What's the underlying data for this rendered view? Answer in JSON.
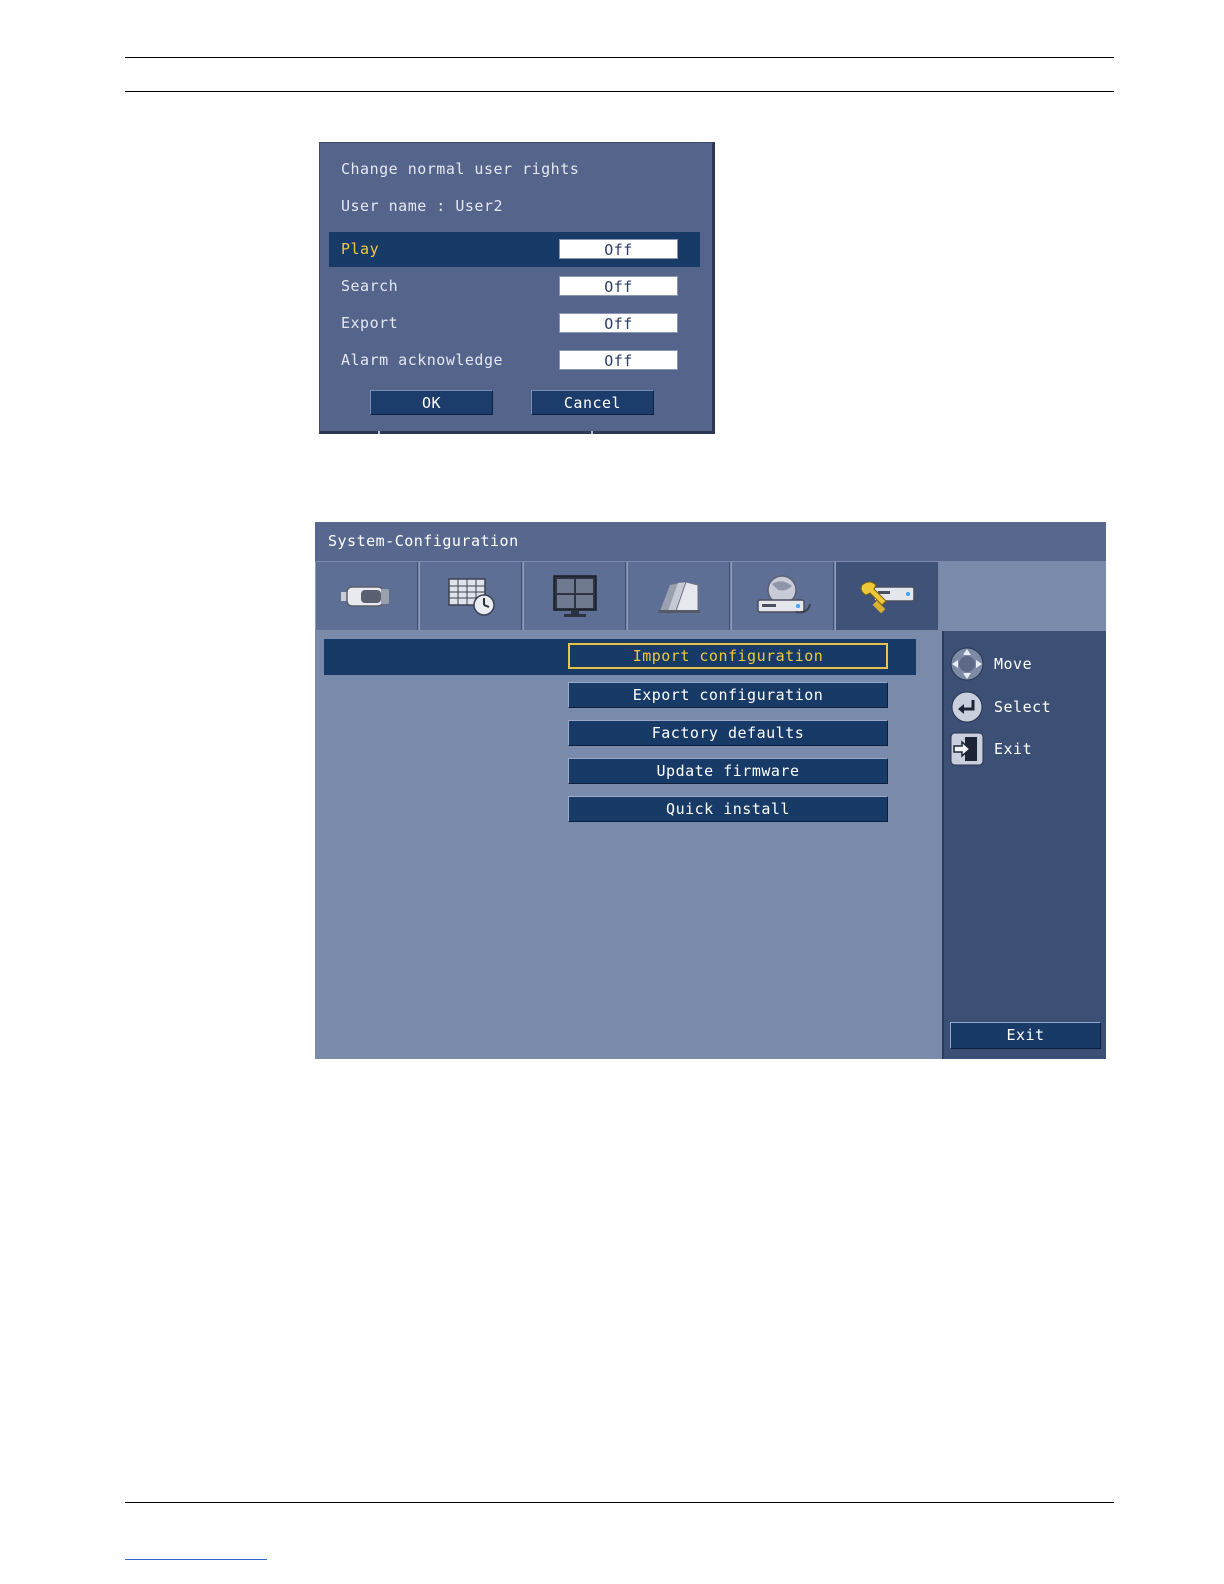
{
  "dialog": {
    "title": "Change normal user rights",
    "user_line": "User name : User2",
    "rows": [
      {
        "label": "Play",
        "value": "Off"
      },
      {
        "label": "Search",
        "value": "Off"
      },
      {
        "label": "Export",
        "value": "Off"
      },
      {
        "label": "Alarm acknowledge",
        "value": "Off"
      }
    ],
    "ok_label": "OK",
    "cancel_label": "Cancel",
    "colors": {
      "background": "#54648a",
      "selected_row": "#173a67",
      "selected_text": "#f0c93a"
    }
  },
  "system_config": {
    "title": "System-Configuration",
    "tabs": [
      {
        "icon": "camera-icon"
      },
      {
        "icon": "schedule-icon"
      },
      {
        "icon": "monitor-icon"
      },
      {
        "icon": "alarm-icon"
      },
      {
        "icon": "network-icon"
      },
      {
        "icon": "system-tools-icon",
        "active": true
      }
    ],
    "buttons": [
      {
        "label": "Import configuration",
        "focused": true
      },
      {
        "label": "Export configuration"
      },
      {
        "label": "Factory defaults"
      },
      {
        "label": "Update firmware"
      },
      {
        "label": "Quick install"
      }
    ],
    "legend": [
      {
        "icon": "move-arrows-icon",
        "label": "Move"
      },
      {
        "icon": "enter-icon",
        "label": "Select"
      },
      {
        "icon": "exit-door-icon",
        "label": "Exit"
      }
    ],
    "exit_label": "Exit",
    "colors": {
      "focus_border": "#e6c24a",
      "button_bg": "#173a67",
      "panel_bg": "#7a8aab",
      "side_bg": "#3c5075"
    }
  }
}
